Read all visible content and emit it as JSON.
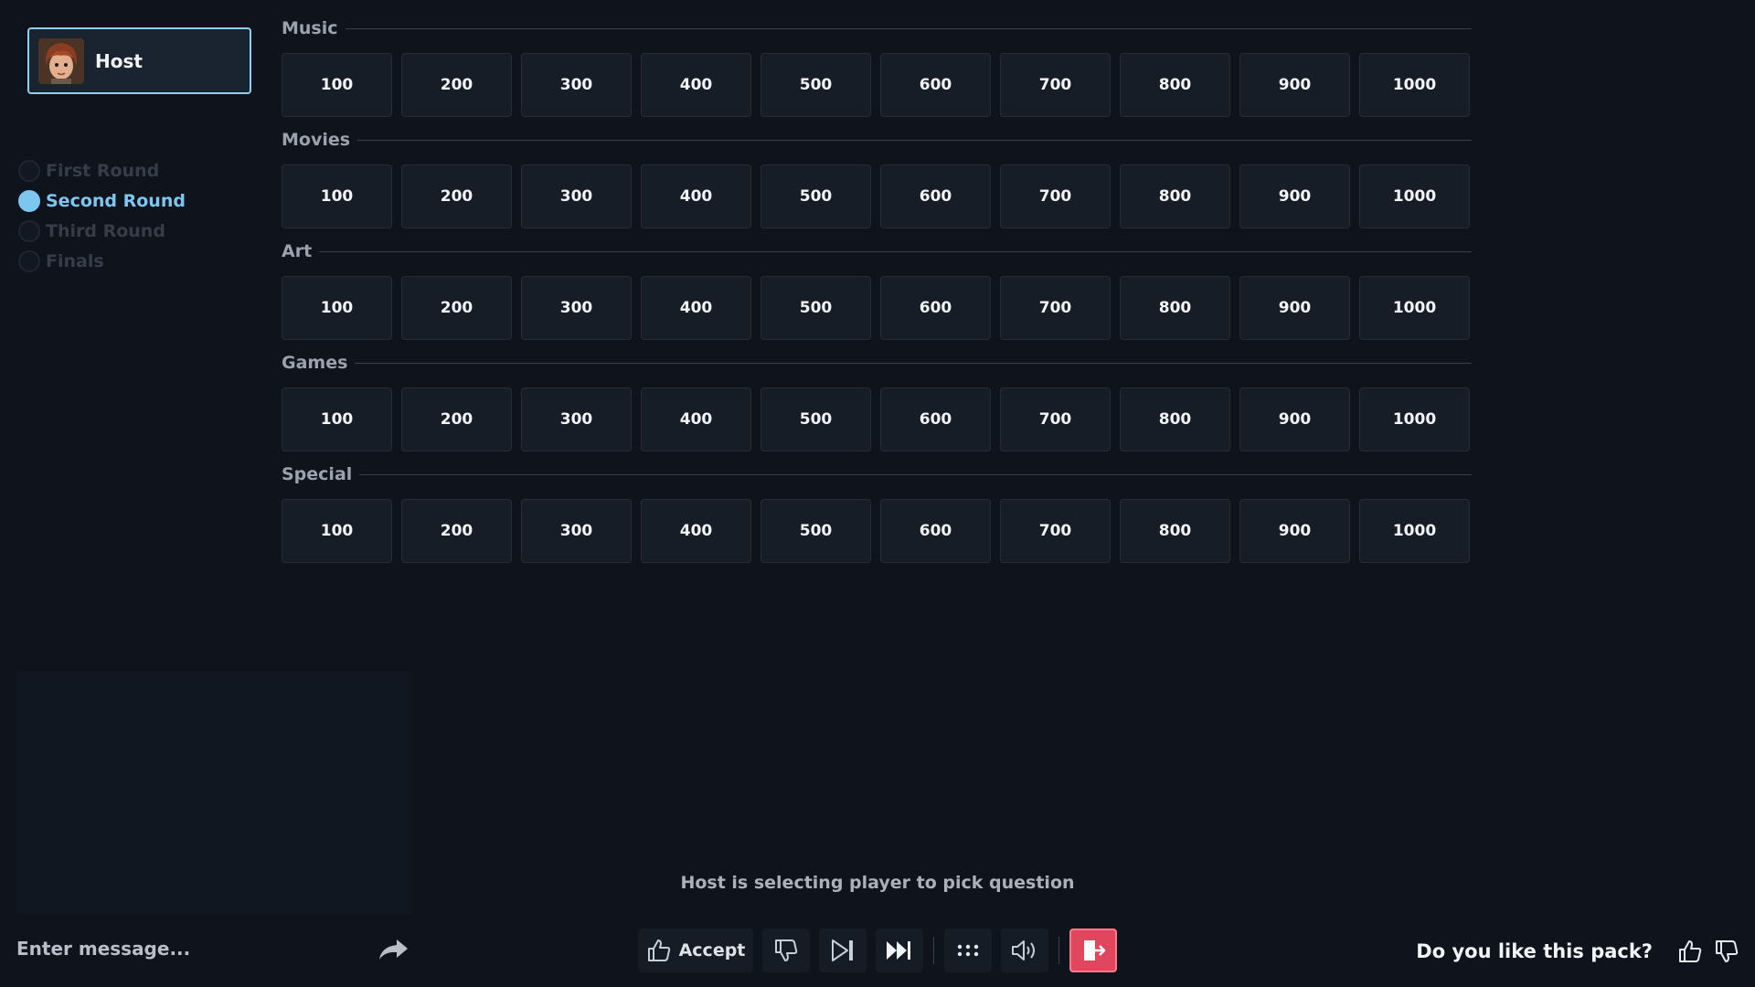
{
  "host": {
    "name": "Host"
  },
  "rounds": [
    {
      "label": "First Round",
      "active": false
    },
    {
      "label": "Second Round",
      "active": true
    },
    {
      "label": "Third Round",
      "active": false
    },
    {
      "label": "Finals",
      "active": false
    }
  ],
  "board": {
    "categories": [
      {
        "name": "Music",
        "values": [
          "100",
          "200",
          "300",
          "400",
          "500",
          "600",
          "700",
          "800",
          "900",
          "1000"
        ]
      },
      {
        "name": "Movies",
        "values": [
          "100",
          "200",
          "300",
          "400",
          "500",
          "600",
          "700",
          "800",
          "900",
          "1000"
        ]
      },
      {
        "name": "Art",
        "values": [
          "100",
          "200",
          "300",
          "400",
          "500",
          "600",
          "700",
          "800",
          "900",
          "1000"
        ]
      },
      {
        "name": "Games",
        "values": [
          "100",
          "200",
          "300",
          "400",
          "500",
          "600",
          "700",
          "800",
          "900",
          "1000"
        ]
      },
      {
        "name": "Special",
        "values": [
          "100",
          "200",
          "300",
          "400",
          "500",
          "600",
          "700",
          "800",
          "900",
          "1000"
        ]
      }
    ]
  },
  "status_text": "Host is selecting player to pick question",
  "chat": {
    "placeholder": "Enter message..."
  },
  "controls": {
    "accept_label": "Accept"
  },
  "rating": {
    "question": "Do you like this pack?"
  },
  "icons": {
    "send": "share-arrow-icon",
    "accept": "thumbs-up-icon",
    "reject": "thumbs-down-icon",
    "skip": "skip-next-icon",
    "fast_forward": "fast-forward-icon",
    "menu": "dots-grid-icon",
    "sound": "speaker-icon",
    "exit": "exit-door-icon"
  },
  "colors": {
    "accent": "#7cc6f0",
    "exit": "#e0475f",
    "background": "#0f141c"
  }
}
